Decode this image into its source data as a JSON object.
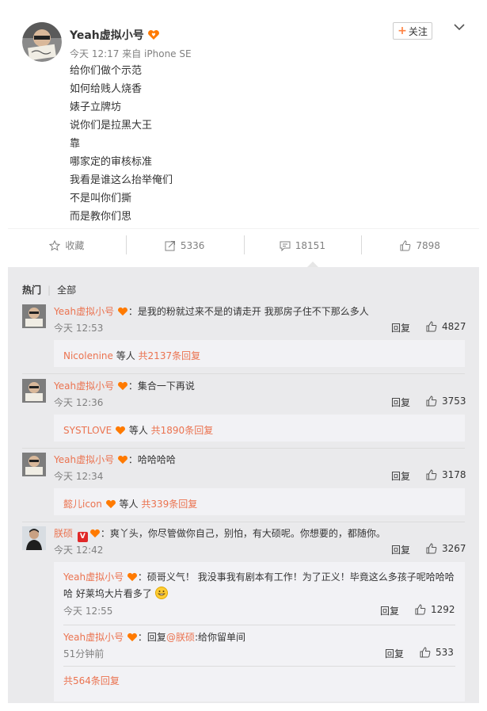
{
  "post": {
    "author": "Yeah虚拟小号",
    "time": "今天 12:17",
    "source": "来自 iPhone SE",
    "follow_label": "关注",
    "lines": [
      "给你们做个示范",
      "如何给贱人烧香",
      "婊子立牌坊",
      "说你们是拉黑大王",
      "靠",
      "哪家定的审核标准",
      "我看是谁这么抬举俺们",
      "不是叫你们撕",
      "而是教你们思"
    ]
  },
  "actions": {
    "favorite": "收藏",
    "repost": "5336",
    "comment": "18151",
    "like": "7898"
  },
  "tabs": {
    "hot": "热门",
    "all": "全部"
  },
  "comments": [
    {
      "author": "Yeah虚拟小号",
      "text": "：是我的粉就过来不是的请走开 我那房子住不下那么多人",
      "time": "今天 12:53",
      "reply_label": "回复",
      "likes": "4827",
      "sub_user": "Nicolenine",
      "sub_mid": " 等人 ",
      "sub_count": "共2137条回复"
    },
    {
      "author": "Yeah虚拟小号",
      "text": "：集合一下再说",
      "time": "今天 12:36",
      "reply_label": "回复",
      "likes": "3753",
      "sub_user": "SYSTLOVE",
      "sub_mid": " 等人 ",
      "sub_count": "共1890条回复"
    },
    {
      "author": "Yeah虚拟小号",
      "text": "：哈哈哈哈",
      "time": "今天 12:34",
      "reply_label": "回复",
      "likes": "3178",
      "sub_user": "懿儿icon",
      "sub_mid": " 等人 ",
      "sub_count": "共339条回复"
    },
    {
      "author": "朕硕",
      "text": "：爽丫头，你尽管做你自己，别怕，有大硕呢。你想要的，都随你。",
      "time": "今天 12:42",
      "reply_label": "回复",
      "likes": "3267",
      "replies": [
        {
          "author": "Yeah虚拟小号",
          "text_line1": "：硕哥义气！ 我没事我有剧本有工作！为了正义！毕竟这么多孩子呢哈哈哈",
          "text_line2": "哈 好莱坞大片看多了",
          "time": "今天 12:55",
          "reply_label": "回复",
          "likes": "1292"
        },
        {
          "author": "Yeah虚拟小号",
          "text_prefix": "：回复",
          "mention": "@朕硕",
          "text_suffix": ":给你留单间",
          "time": "51分钟前",
          "reply_label": "回复",
          "likes": "533"
        }
      ],
      "more_label": "共564条回复"
    }
  ],
  "colors": {
    "accent": "#eb7350",
    "panel": "#eaeaec",
    "sub_panel": "#f2f2f5"
  }
}
